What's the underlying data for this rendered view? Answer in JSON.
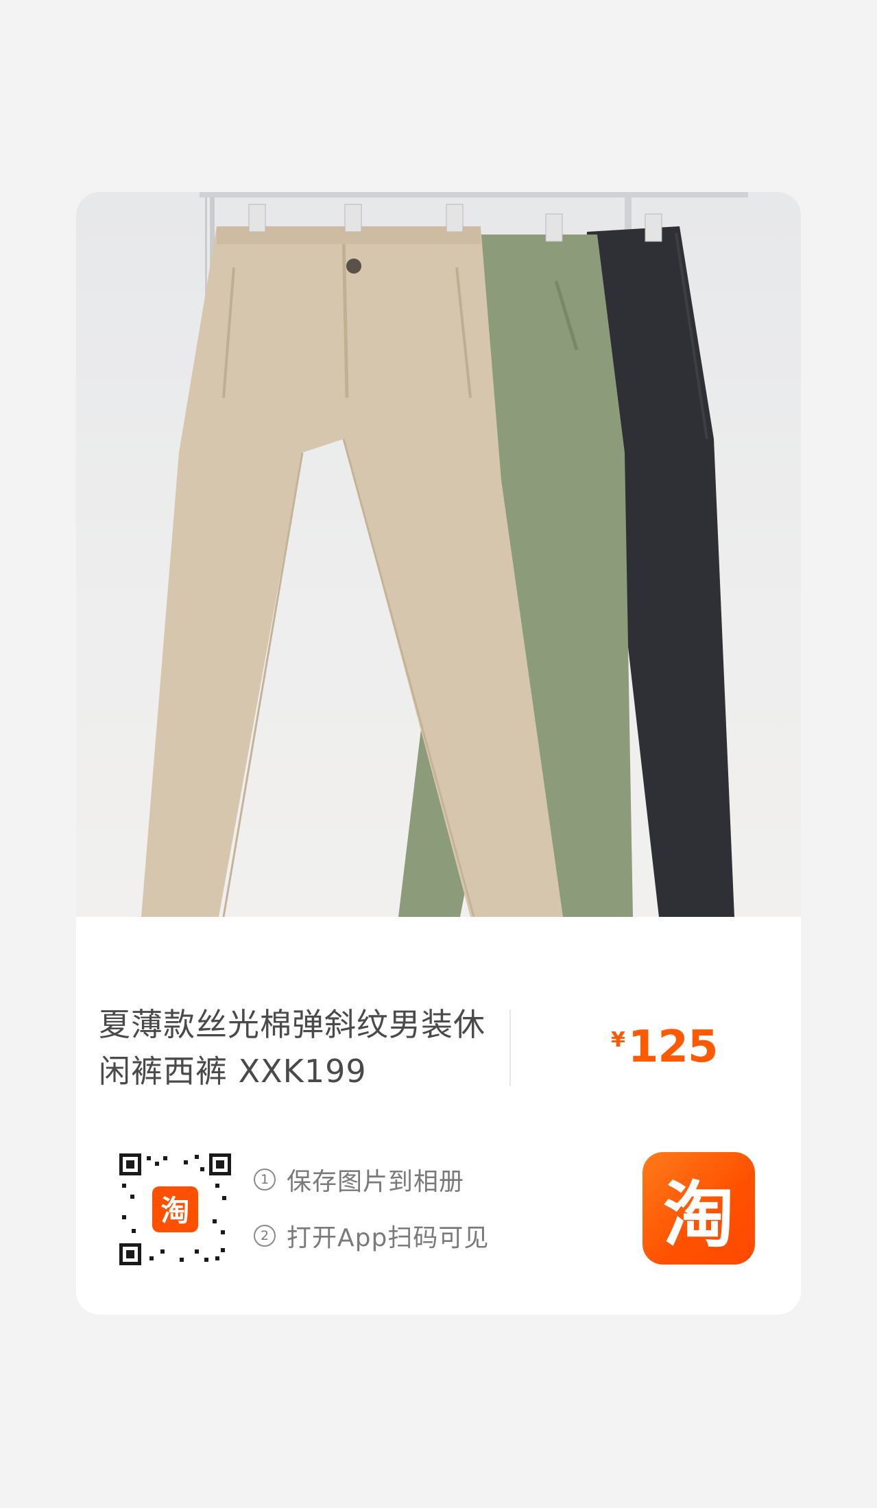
{
  "product": {
    "title": "夏薄款丝光棉弹斜纹男装休闲裤西裤 XXK199",
    "price_currency": "¥",
    "price_value": "125"
  },
  "share": {
    "steps": [
      {
        "num": "1",
        "text": "保存图片到相册"
      },
      {
        "num": "2",
        "text": "打开App扫码可见"
      }
    ]
  },
  "brand": {
    "logo_char": "淘",
    "mini_logo_char": "淘",
    "accent": "#ff5000"
  }
}
